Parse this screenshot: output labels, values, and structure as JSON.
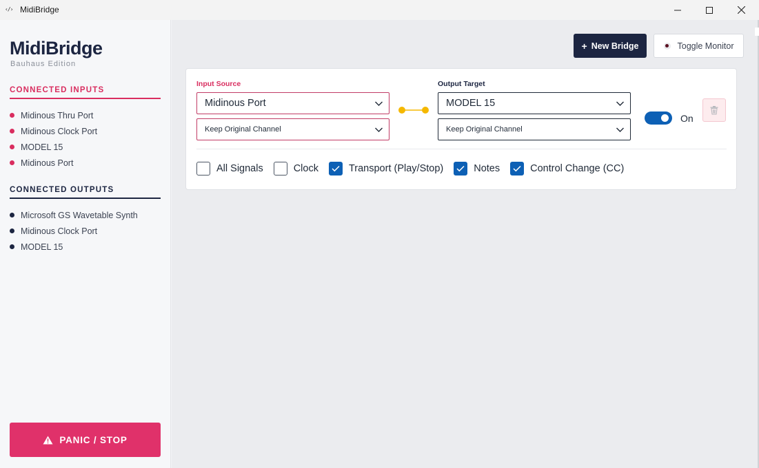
{
  "window": {
    "title": "MidiBridge",
    "icon_glyph": "‹/›",
    "controls": [
      "minimize-icon",
      "maximize-icon",
      "close-icon"
    ]
  },
  "sidebar": {
    "brand": {
      "title": "MidiBridge",
      "subtitle": "Bauhaus Edition"
    },
    "inputs": {
      "heading": "CONNECTED INPUTS",
      "items": [
        "Midinous Thru Port",
        "Midinous Clock Port",
        "MODEL 15",
        "Midinous Port"
      ]
    },
    "outputs": {
      "heading": "CONNECTED OUTPUTS",
      "items": [
        "Microsoft GS Wavetable Synth",
        "Midinous Clock Port",
        "MODEL 15"
      ]
    },
    "panic": {
      "label": "PANIC / STOP",
      "icon": "warning-icon"
    }
  },
  "toolbar": {
    "new_bridge_label": "New Bridge",
    "new_bridge_icon": "+",
    "toggle_monitor_label": "Toggle Monitor"
  },
  "bridge": {
    "input_label": "Input Source",
    "input_port": "Midinous Port",
    "input_channel": "Keep Original Channel",
    "output_label": "Output Target",
    "output_port": "MODEL 15",
    "output_channel": "Keep Original Channel",
    "enabled": true,
    "enabled_label": "On",
    "filters": [
      {
        "label": "All Signals",
        "checked": false
      },
      {
        "label": "Clock",
        "checked": false
      },
      {
        "label": "Transport (Play/Stop)",
        "checked": true
      },
      {
        "label": "Notes",
        "checked": true
      },
      {
        "label": "Control Change (CC)",
        "checked": true
      }
    ]
  },
  "colors": {
    "accent_input": "#d92d5f",
    "accent_output": "#1c2541",
    "accent_toggle": "#0d60b5",
    "connector": "#f5b800",
    "panic": "#e0316a"
  }
}
